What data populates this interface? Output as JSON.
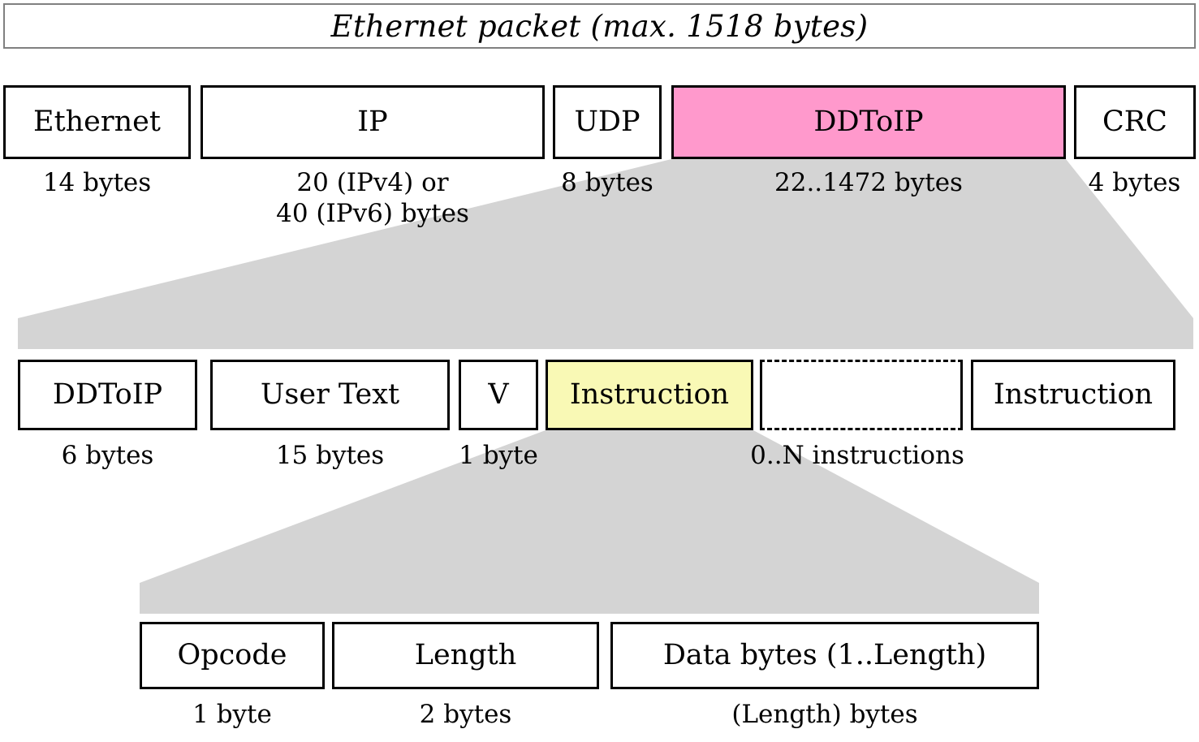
{
  "title": {
    "text": "Ethernet packet (max. 1518 bytes)"
  },
  "colors": {
    "highlight_ddtoip": "#ff99cc",
    "highlight_instruction": "#f9f9b5",
    "funnel_gray": "#d4d4d4",
    "box_border": "#000000",
    "title_border": "#808080"
  },
  "rows": [
    {
      "name": "ethernet-packet-row",
      "fields": [
        {
          "label": "Ethernet",
          "caption": "14 bytes"
        },
        {
          "label": "IP",
          "caption": "20 (IPv4) or\n40 (IPv6) bytes"
        },
        {
          "label": "UDP",
          "caption": "8 bytes"
        },
        {
          "label": "DDToIP",
          "caption": "22..1472 bytes"
        },
        {
          "label": "CRC",
          "caption": "4 bytes"
        }
      ]
    },
    {
      "name": "ddtoip-payload-row",
      "fields": [
        {
          "label": "DDToIP",
          "caption": "6 bytes"
        },
        {
          "label": "User Text",
          "caption": "15 bytes"
        },
        {
          "label": "V",
          "caption": "1 byte"
        },
        {
          "label": "Instruction",
          "caption": "0..N instructions"
        },
        {
          "label": "",
          "caption": ""
        },
        {
          "label": "Instruction",
          "caption": ""
        }
      ]
    },
    {
      "name": "instruction-row",
      "fields": [
        {
          "label": "Opcode",
          "caption": "1 byte"
        },
        {
          "label": "Length",
          "caption": "2 bytes"
        },
        {
          "label": "Data bytes (1..Length)",
          "caption": "(Length) bytes"
        }
      ]
    }
  ]
}
